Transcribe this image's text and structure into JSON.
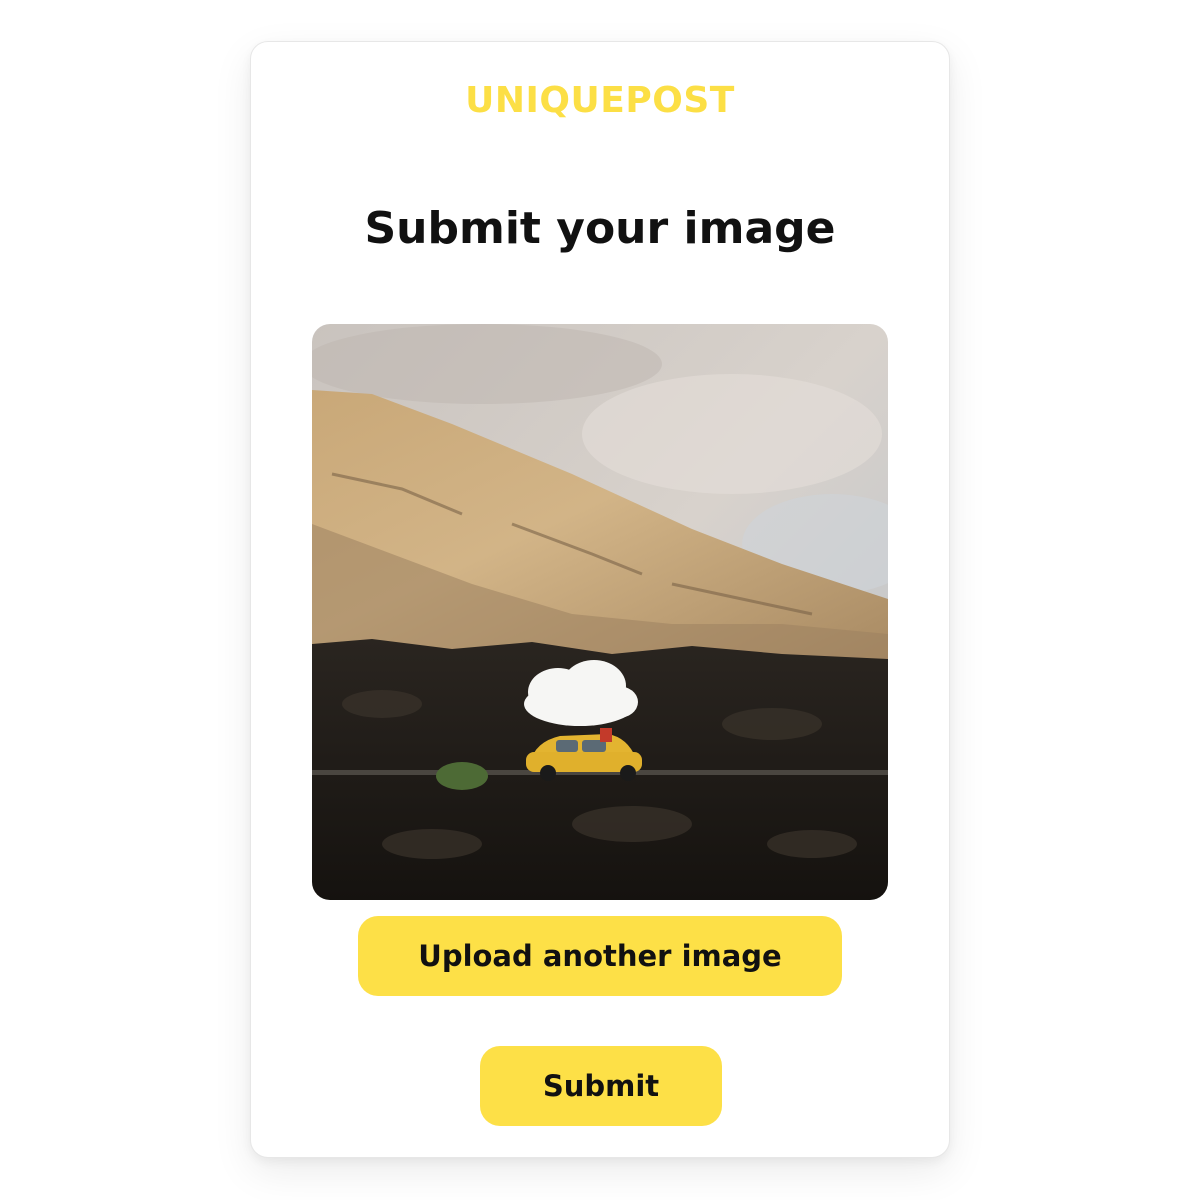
{
  "brand": {
    "name": "UNIQUEPOST",
    "color": "#fcdf45"
  },
  "page_title": "Submit your image",
  "preview": {
    "icon": "image-preview",
    "subject": "photo"
  },
  "actions": {
    "upload_label": "Upload another image",
    "submit_label": "Submit",
    "button_color": "#fde047"
  }
}
